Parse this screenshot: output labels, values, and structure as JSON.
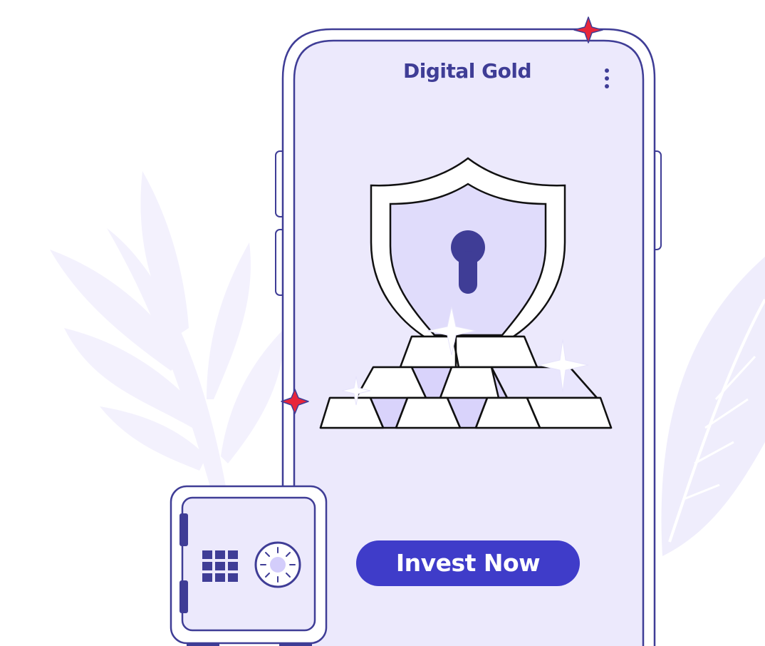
{
  "app": {
    "title": "Digital Gold",
    "menu_icon": "more-vertical-icon"
  },
  "hero": {
    "illustration": "shield-lock-over-gold-bars",
    "icons": [
      "shield-icon",
      "keyhole-icon",
      "gold-bars-icon",
      "sparkle-icon"
    ]
  },
  "cta": {
    "label": "Invest Now"
  },
  "decor": {
    "safe_icon": "safe-icon",
    "keypad_icon": "keypad-icon",
    "dial_icon": "dial-icon",
    "sparkle_icon": "sparkle-icon",
    "leaf_icon": "leaf-icon"
  },
  "colors": {
    "outline": "#3f3d96",
    "phone_fill": "#ece9fc",
    "shield_inner": "#e0dcfb",
    "button": "#3f3cc9",
    "sparkle": "#e8263a",
    "leaf": "#f2f0fd",
    "gold_bar": "#ffffff",
    "gold_shadow": "#d9d3fb"
  }
}
